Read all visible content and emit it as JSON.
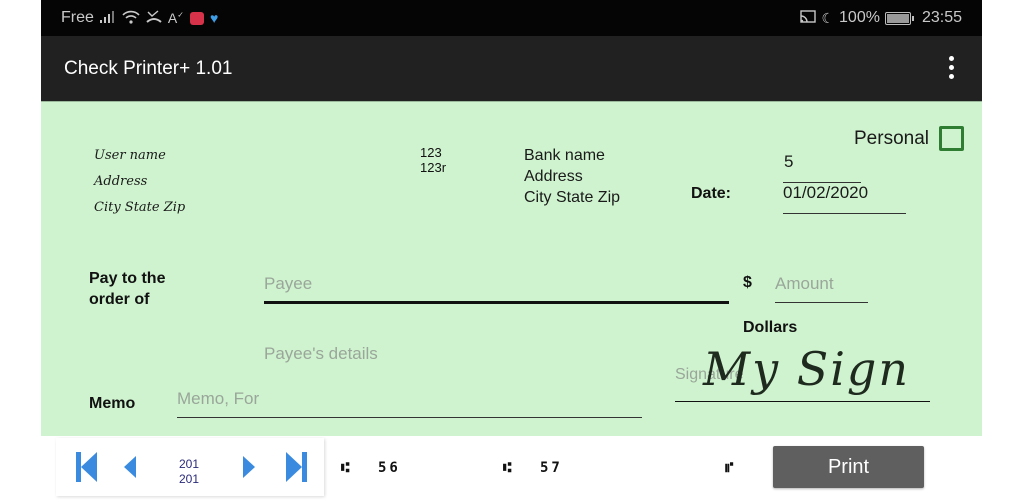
{
  "statusbar": {
    "carrier": "Free",
    "battery": "100%",
    "time": "23:55",
    "icons_left": [
      "signal-icon",
      "wifi-icon",
      "missed-call-icon",
      "text-check-icon",
      "huawei-app-icon",
      "health-app-icon"
    ],
    "icons_right": [
      "cast-icon",
      "moon-icon",
      "battery-icon"
    ]
  },
  "appbar": {
    "title": "Check Printer+ 1.01",
    "menu_icon": "more-vertical-icon"
  },
  "check": {
    "owner": {
      "name": "User name",
      "address": "Address",
      "city_state_zip": "City State Zip"
    },
    "routing_top": "123",
    "routing_bottom": "123r",
    "bank": {
      "name": "Bank name",
      "address": "Address",
      "city_state_zip": "City State Zip"
    },
    "personal_label": "Personal",
    "personal_checked": false,
    "check_number": "5",
    "date_label": "Date:",
    "date_value": "01/02/2020",
    "pay_label_line1": "Pay to the",
    "pay_label_line2": "order of",
    "payee_placeholder": "Payee",
    "payee_value": "",
    "dollar_sign": "$",
    "amount_placeholder": "Amount",
    "amount_value": "",
    "dollars_label": "Dollars",
    "payee_details_placeholder": "Payee's details",
    "memo_label": "Memo",
    "memo_placeholder": "Memo, For",
    "signature_placeholder": "Signature",
    "signature_text": "My Sign"
  },
  "bottombar": {
    "page_current": "201",
    "page_total": "201",
    "micr_1": "56",
    "micr_2": "57",
    "print_label": "Print"
  }
}
